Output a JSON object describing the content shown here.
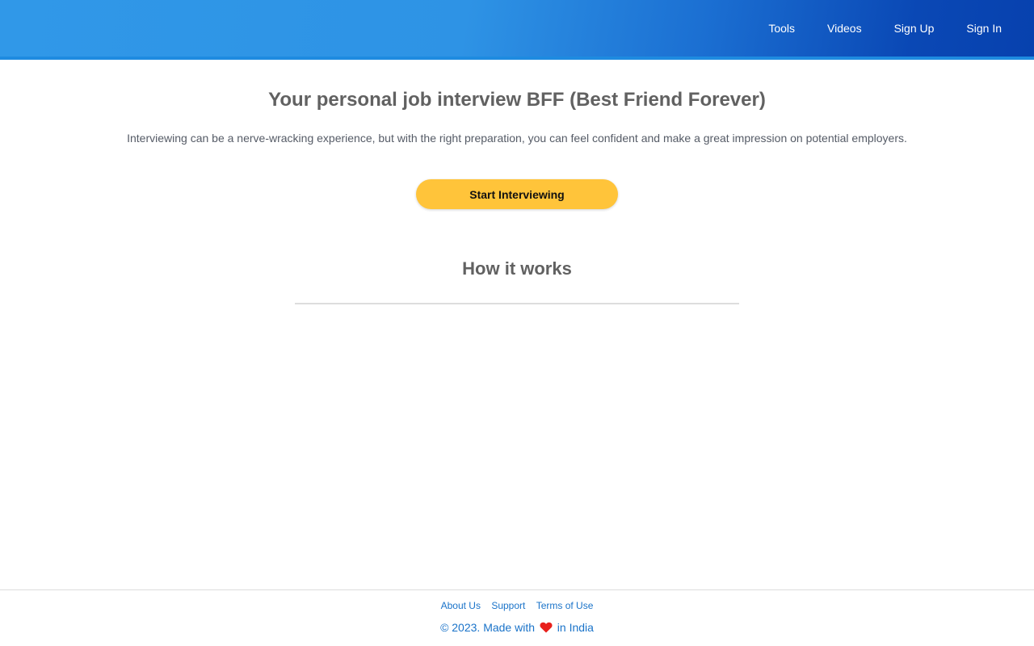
{
  "header": {
    "nav": {
      "tools": "Tools",
      "videos": "Videos",
      "sign_up": "Sign Up",
      "sign_in": "Sign In"
    }
  },
  "hero": {
    "title": "Your personal job interview BFF (Best Friend Forever)",
    "subtitle": "Interviewing can be a nerve-wracking experience, but with the right preparation, you can feel confident and make a great impression on potential employers.",
    "cta_label": "Start Interviewing"
  },
  "how_it_works": {
    "title": "How it works"
  },
  "footer": {
    "links": {
      "about": "About Us",
      "support": "Support",
      "terms": "Terms of Use"
    },
    "copyright_prefix": "© 2023. Made with",
    "heart_icon": "heart-icon",
    "copyright_suffix": "in India"
  },
  "colors": {
    "header_gradient_start": "#3098e8",
    "header_gradient_end": "#0741ae",
    "cta_background": "#ffc43a",
    "link": "#1a73c9",
    "heart": "#e8201c"
  }
}
